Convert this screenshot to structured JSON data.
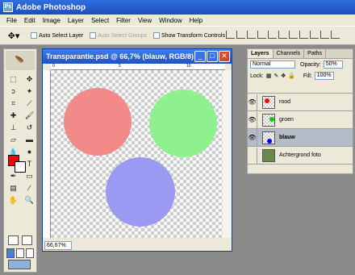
{
  "app": {
    "title": "Adobe Photoshop"
  },
  "menu": [
    "File",
    "Edit",
    "Image",
    "Layer",
    "Select",
    "Filter",
    "View",
    "Window",
    "Help"
  ],
  "options": {
    "auto_select_layer": "Auto Select Layer",
    "auto_select_groups": "Auto Select Groups",
    "show_transform_controls": "Show Transform Controls"
  },
  "document": {
    "title": "Transparantie.psd @ 66,7% (blauw, RGB/8)",
    "zoom": "66,67%",
    "ruler_labels": [
      "0",
      "5",
      "10"
    ],
    "circles": [
      {
        "name": "rood",
        "color": "#f28a8a"
      },
      {
        "name": "groen",
        "color": "#8ef08e"
      },
      {
        "name": "blauw",
        "color": "#9a9af2"
      }
    ]
  },
  "colors": {
    "foreground": "#ff0000",
    "background": "#ffffff",
    "selected_layer": "#b4bcc8"
  },
  "layers_panel": {
    "tabs": [
      "Layers",
      "Channels",
      "Paths"
    ],
    "blend_mode": "Normal",
    "opacity_label": "Opacity:",
    "opacity_value": "50%",
    "lock_label": "Lock:",
    "fill_label": "Fill:",
    "fill_value": "100%",
    "layers": [
      {
        "name": "rood",
        "thumb_color": "#ff0000",
        "visible": true,
        "selected": false
      },
      {
        "name": "groen",
        "thumb_color": "#00cc00",
        "visible": true,
        "selected": false
      },
      {
        "name": "blauw",
        "thumb_color": "#0000ee",
        "visible": true,
        "selected": true
      },
      {
        "name": "Achtergrond foto",
        "thumb_color": "#6b8a4a",
        "visible": false,
        "selected": false
      }
    ]
  }
}
